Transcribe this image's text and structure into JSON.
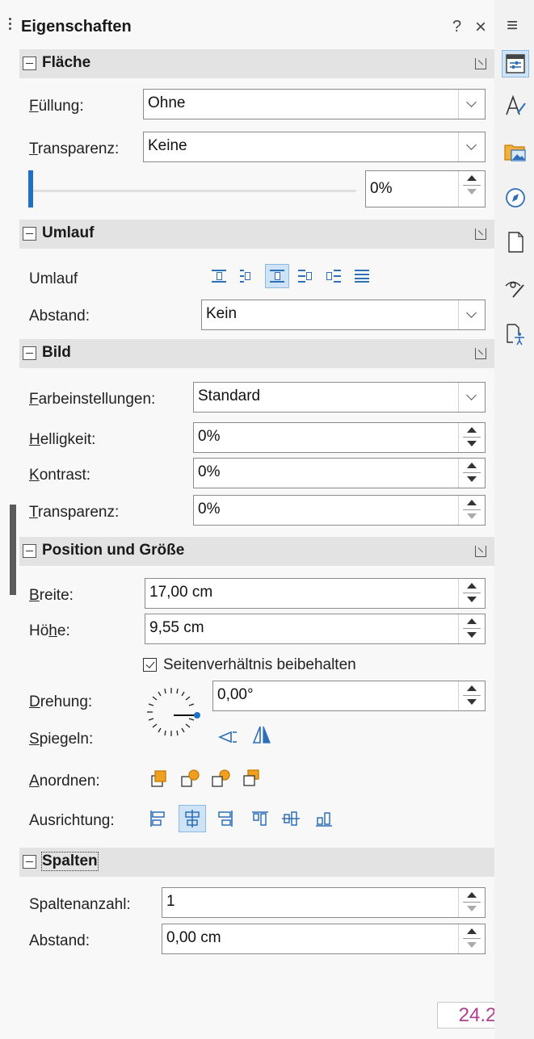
{
  "panel": {
    "title": "Eigenschaften",
    "help_glyph": "?",
    "close_glyph": "×",
    "menu_glyph": "≡"
  },
  "flaeche": {
    "header": "Fläche",
    "fill_label": "Füllung:",
    "fill_value": "Ohne",
    "transparency_label": "Transparenz:",
    "transparency_value": "Keine",
    "transparency_percent": "0%",
    "slider_level": 0
  },
  "umlauf": {
    "header": "Umlauf",
    "wrap_label": "Umlauf",
    "spacing_label": "Abstand:",
    "spacing_value": "Kein",
    "active_wrap_index": 2
  },
  "bild": {
    "header": "Bild",
    "color_label": "Farbeinstellungen:",
    "color_value": "Standard",
    "brightness_label": "Helligkeit:",
    "brightness_value": "0%",
    "contrast_label": "Kontrast:",
    "contrast_value": "0%",
    "transparency_label": "Transparenz:",
    "transparency_value": "0%"
  },
  "position": {
    "header": "Position und Größe",
    "width_label": "Breite:",
    "width_value": "17,00 cm",
    "height_label": "Höhe:",
    "height_value": "9,55 cm",
    "keep_ratio_label": "Seitenverhältnis beibehalten",
    "keep_ratio_checked": true,
    "rotation_label": "Drehung:",
    "rotation_value": "0,00°",
    "mirror_label": "Spiegeln:",
    "arrange_label": "Anordnen:",
    "align_label": "Ausrichtung:"
  },
  "spalten": {
    "header": "Spalten",
    "count_label": "Spaltenanzahl:",
    "count_value": "1",
    "spacing_label": "Abstand:",
    "spacing_value": "0,00 cm"
  },
  "tabs": [
    "properties-icon",
    "styles-icon",
    "gallery-icon",
    "navigator-icon",
    "page-icon",
    "style-inspector-icon",
    "accessibility-check-icon"
  ],
  "version": "24.2",
  "colors": {
    "accent": "#1e6fc7",
    "icon_blue": "#2d6fb8",
    "version_text": "#b0408e",
    "header_bg": "#e3e3e3"
  }
}
